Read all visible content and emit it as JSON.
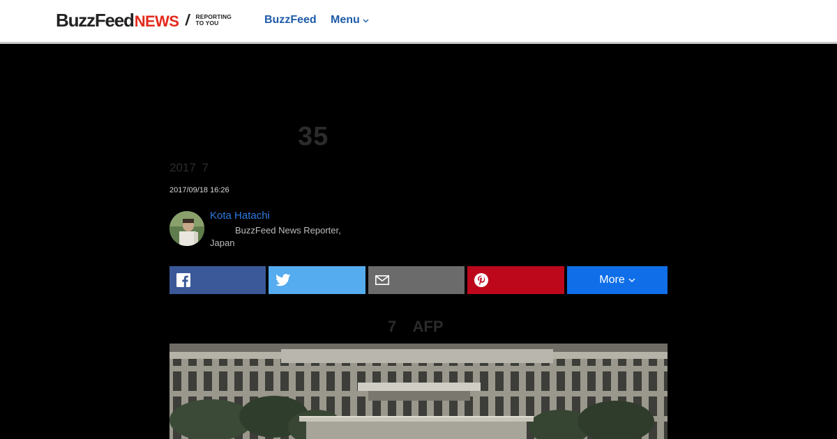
{
  "header": {
    "logo": {
      "brand": "BuzzFeed",
      "news": "NEWS",
      "slash": "/",
      "tagline_line1": "REPORTING",
      "tagline_line2": "TO YOU"
    },
    "nav": {
      "buzzfeed_label": "BuzzFeed",
      "menu_label": "Menu"
    }
  },
  "article": {
    "headline": "35",
    "subhead": "2017 7",
    "timestamp": "2017/09/18 16:26",
    "author": {
      "name": "Kota Hatachi",
      "role": "BuzzFeed News Reporter, Japan"
    },
    "share": {
      "more_label": "More"
    },
    "caption": "7 AFP"
  },
  "icons": {
    "facebook": "facebook-icon",
    "twitter": "twitter-icon",
    "email": "email-icon",
    "pinterest": "pinterest-icon",
    "chevron": "chevron-down-icon"
  },
  "colors": {
    "accent_red": "#e32a1d",
    "link_blue": "#1d5ba8",
    "facebook": "#3b5998",
    "twitter": "#55acee",
    "email": "#6b6b6b",
    "pinterest": "#bd081c",
    "more": "#0f6ee8"
  }
}
